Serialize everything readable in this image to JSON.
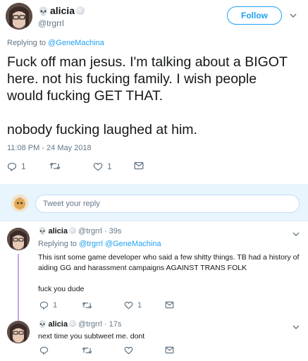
{
  "main": {
    "display_name": "alicia",
    "skull_emoji": "💀",
    "handle": "@trgrrl",
    "follow_label": "Follow",
    "replying_prefix": "Replying to",
    "replying_to": "@GeneMachina",
    "text_lines": [
      "Fuck off man jesus. I'm talking about a BIGOT",
      "here. not his fucking family. I wish people",
      "would fucking GET THAT.",
      "",
      "nobody fucking laughed at him."
    ],
    "timestamp": "11:08 PM - 24 May 2018",
    "reply_count": "1",
    "retweet_count": "",
    "like_count": "1"
  },
  "composer": {
    "placeholder": "Tweet your reply"
  },
  "replies": [
    {
      "display_name": "alicia",
      "skull_emoji": "💀",
      "handle": "@trgrrl",
      "time": "· 39s",
      "replying_prefix": "Replying to",
      "replying_to_1": "@trgrrl",
      "replying_to_2": "@GeneMachina",
      "text_line_1": "This isnt some game developer who said a few shitty things. TB had a history of",
      "text_line_2": "aiding GG and harassment campaigns AGAINST TRANS FOLK",
      "text_line_3": "fuck you dude",
      "reply_count": "1",
      "like_count": "1"
    },
    {
      "display_name": "alicia",
      "skull_emoji": "💀",
      "handle": "@trgrrl",
      "time": "· 17s",
      "text_line_1": "next time you subtweet me. dont"
    }
  ],
  "colors": {
    "accent": "#1da1f2",
    "thread_line": "#c9a4e6",
    "muted": "#657786"
  }
}
